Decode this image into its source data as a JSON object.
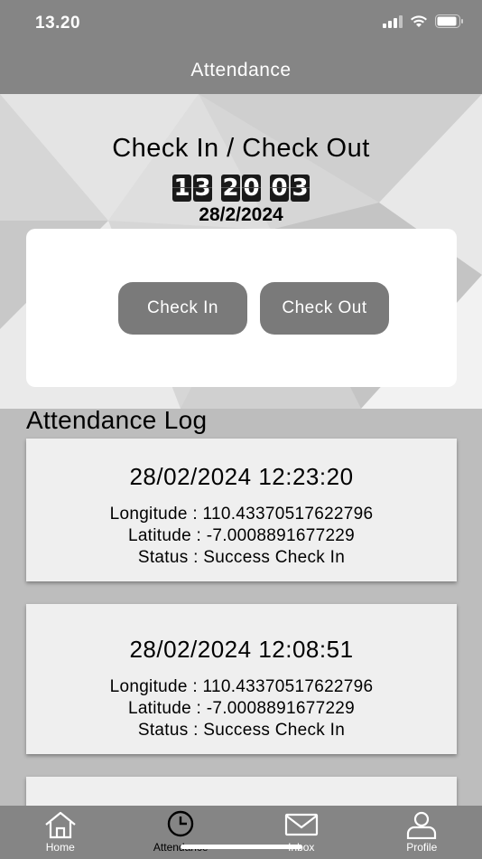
{
  "status_bar": {
    "time": "13.20"
  },
  "app_bar": {
    "title": "Attendance"
  },
  "hero": {
    "title": "Check In / Check Out",
    "clock": {
      "hours": [
        "1",
        "3"
      ],
      "minutes": [
        "2",
        "0"
      ],
      "seconds": [
        "0",
        "3"
      ]
    },
    "date": "28/2/2024"
  },
  "actions": {
    "check_in_label": "Check In",
    "check_out_label": "Check Out"
  },
  "log": {
    "title": "Attendance Log",
    "entries": [
      {
        "datetime": "28/02/2024 12:23:20",
        "longitude": "Longitude : 110.43370517622796",
        "latitude": "Latitude : -7.0008891677229",
        "status": "Status : Success Check In"
      },
      {
        "datetime": "28/02/2024 12:08:51",
        "longitude": "Longitude : 110.43370517622796",
        "latitude": "Latitude : -7.0008891677229",
        "status": "Status : Success Check In"
      }
    ]
  },
  "bottom_nav": {
    "items": [
      {
        "label": "Home",
        "icon": "home-icon"
      },
      {
        "label": "Attendance",
        "icon": "clock-icon",
        "active": true
      },
      {
        "label": "Inbox",
        "icon": "mail-icon"
      },
      {
        "label": "Profile",
        "icon": "user-icon"
      }
    ]
  },
  "colors": {
    "bar": "#858585",
    "button": "#7a7a7a",
    "card": "#efefef",
    "background": "#bdbdbd"
  }
}
